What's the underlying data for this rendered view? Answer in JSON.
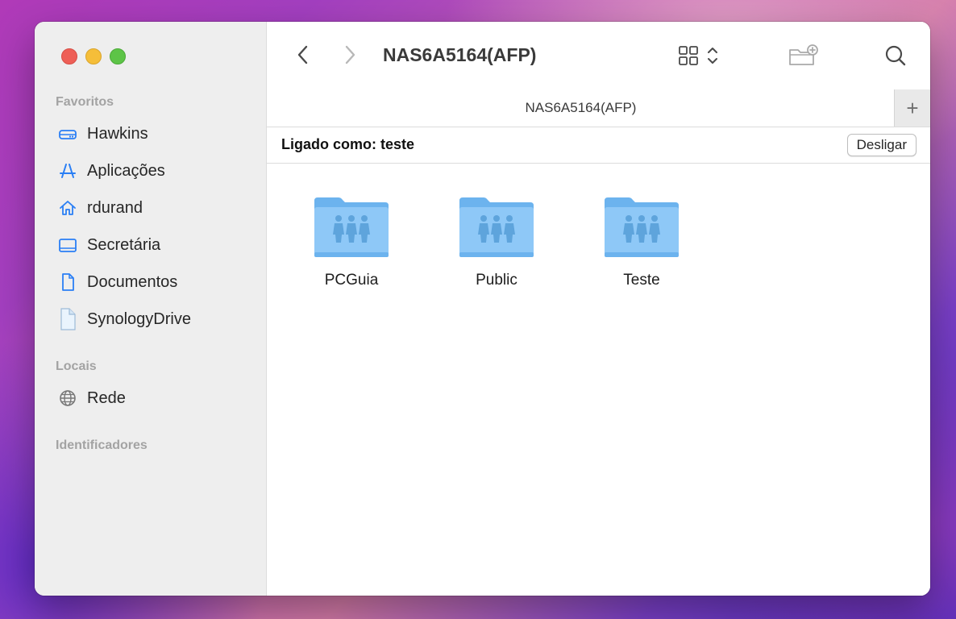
{
  "window": {
    "title": "NAS6A5164(AFP)"
  },
  "sidebar": {
    "favorites_title": "Favoritos",
    "favorites": [
      {
        "label": "Hawkins",
        "icon": "drive-icon"
      },
      {
        "label": "Aplicações",
        "icon": "applications-icon"
      },
      {
        "label": "rdurand",
        "icon": "home-icon"
      },
      {
        "label": "Secretária",
        "icon": "desktop-icon"
      },
      {
        "label": "Documentos",
        "icon": "document-icon"
      },
      {
        "label": "SynologyDrive",
        "icon": "file-icon"
      }
    ],
    "locations_title": "Locais",
    "locations": [
      {
        "label": "Rede",
        "icon": "network-globe-icon"
      }
    ],
    "tags_title": "Identificadores"
  },
  "tabbar": {
    "tab_label": "NAS6A5164(AFP)",
    "add_label": "+"
  },
  "infobar": {
    "connected_as": "Ligado como: teste",
    "disconnect_label": "Desligar"
  },
  "folders": [
    {
      "name": "PCGuia"
    },
    {
      "name": "Public"
    },
    {
      "name": "Teste"
    }
  ],
  "colors": {
    "accent": "#2a7ff5",
    "folder": "#8ec8f7"
  }
}
